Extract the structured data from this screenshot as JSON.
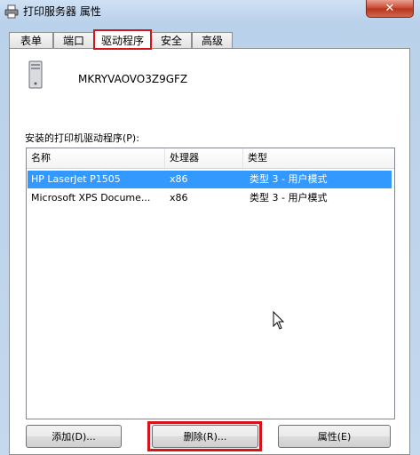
{
  "window": {
    "title": "打印服务器 属性",
    "close_glyph": "✕"
  },
  "tabs": [
    {
      "label": "表单"
    },
    {
      "label": "端口"
    },
    {
      "label": "驱动程序"
    },
    {
      "label": "安全"
    },
    {
      "label": "高级"
    }
  ],
  "server": {
    "name": "MKRYVAOVO3Z9GFZ"
  },
  "drivers": {
    "label": "安装的打印机驱动程序(P):",
    "columns": [
      "名称",
      "处理器",
      "类型"
    ],
    "rows": [
      {
        "name": "HP LaserJet P1505",
        "processor": "x86",
        "type": "类型 3 - 用户模式"
      },
      {
        "name": "Microsoft XPS Docume...",
        "processor": "x86",
        "type": "类型 3 - 用户模式"
      }
    ],
    "selected_row": 0
  },
  "buttons": {
    "add": "添加(D)...",
    "delete": "删除(R)...",
    "properties": "属性(E)"
  },
  "colors": {
    "selection": "#3399ff",
    "highlight": "#d4141b"
  }
}
